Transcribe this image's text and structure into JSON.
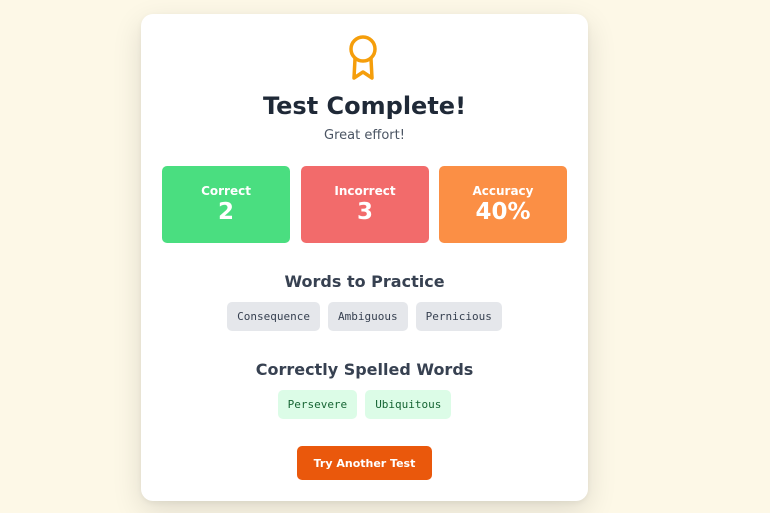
{
  "result": {
    "icon": "award-icon",
    "title": "Test Complete!",
    "subtitle": "Great effort!"
  },
  "stats": [
    {
      "label": "Correct",
      "value": "2",
      "color": "#4ade80"
    },
    {
      "label": "Incorrect",
      "value": "3",
      "color": "#f26b6b"
    },
    {
      "label": "Accuracy",
      "value": "40%",
      "color": "#fb8f45"
    }
  ],
  "practice": {
    "title": "Words to Practice",
    "words": [
      "Consequence",
      "Ambiguous",
      "Pernicious"
    ]
  },
  "correct_words": {
    "title": "Correctly Spelled Words",
    "words": [
      "Persevere",
      "Ubiquitous"
    ]
  },
  "actions": {
    "retry_label": "Try Another Test",
    "accent": "#ea580c"
  }
}
